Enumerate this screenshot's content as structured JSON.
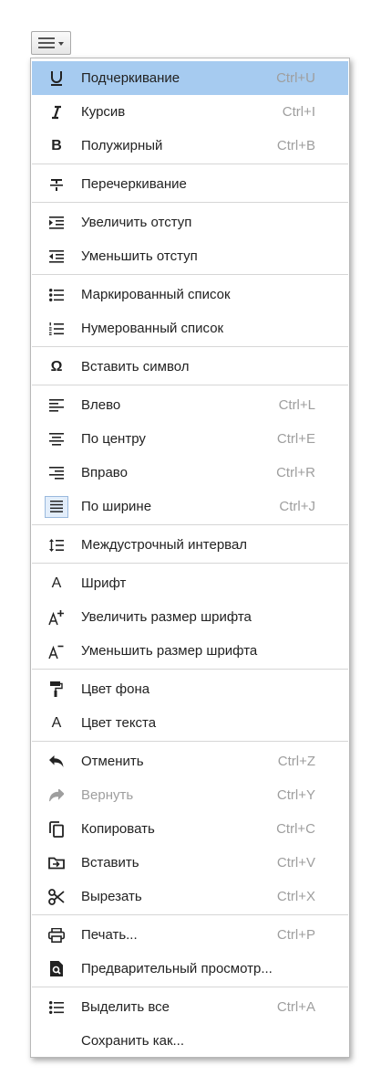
{
  "menu": {
    "items": [
      {
        "label": "Подчеркивание",
        "shortcut": "Ctrl+U"
      },
      {
        "label": "Курсив",
        "shortcut": "Ctrl+I"
      },
      {
        "label": "Полужирный",
        "shortcut": "Ctrl+B"
      },
      {
        "label": "Перечеркивание",
        "shortcut": ""
      },
      {
        "label": "Увеличить отступ",
        "shortcut": ""
      },
      {
        "label": "Уменьшить отступ",
        "shortcut": ""
      },
      {
        "label": "Маркированный список",
        "shortcut": ""
      },
      {
        "label": "Нумерованный список",
        "shortcut": ""
      },
      {
        "label": "Вставить символ",
        "shortcut": ""
      },
      {
        "label": "Влево",
        "shortcut": "Ctrl+L"
      },
      {
        "label": "По центру",
        "shortcut": "Ctrl+E"
      },
      {
        "label": "Вправо",
        "shortcut": "Ctrl+R"
      },
      {
        "label": "По ширине",
        "shortcut": "Ctrl+J"
      },
      {
        "label": "Междустрочный интервал",
        "shortcut": ""
      },
      {
        "label": "Шрифт",
        "shortcut": ""
      },
      {
        "label": "Увеличить размер шрифта",
        "shortcut": ""
      },
      {
        "label": "Уменьшить размер шрифта",
        "shortcut": ""
      },
      {
        "label": "Цвет фона",
        "shortcut": ""
      },
      {
        "label": "Цвет текста",
        "shortcut": ""
      },
      {
        "label": "Отменить",
        "shortcut": "Ctrl+Z"
      },
      {
        "label": "Вернуть",
        "shortcut": "Ctrl+Y"
      },
      {
        "label": "Копировать",
        "shortcut": "Ctrl+C"
      },
      {
        "label": "Вставить",
        "shortcut": "Ctrl+V"
      },
      {
        "label": "Вырезать",
        "shortcut": "Ctrl+X"
      },
      {
        "label": "Печать...",
        "shortcut": "Ctrl+P"
      },
      {
        "label": "Предварительный просмотр...",
        "shortcut": ""
      },
      {
        "label": "Выделить все",
        "shortcut": "Ctrl+A"
      },
      {
        "label": "Сохранить как...",
        "shortcut": ""
      }
    ],
    "icon_glyphs": {
      "underline": "U",
      "italic": "I",
      "bold": "B",
      "omega": "Ω",
      "font": "A"
    }
  },
  "colors": {
    "highlight": "#a6cbf0",
    "text": "#222222",
    "muted": "#9e9e9e",
    "separator": "#d6d6d6"
  }
}
